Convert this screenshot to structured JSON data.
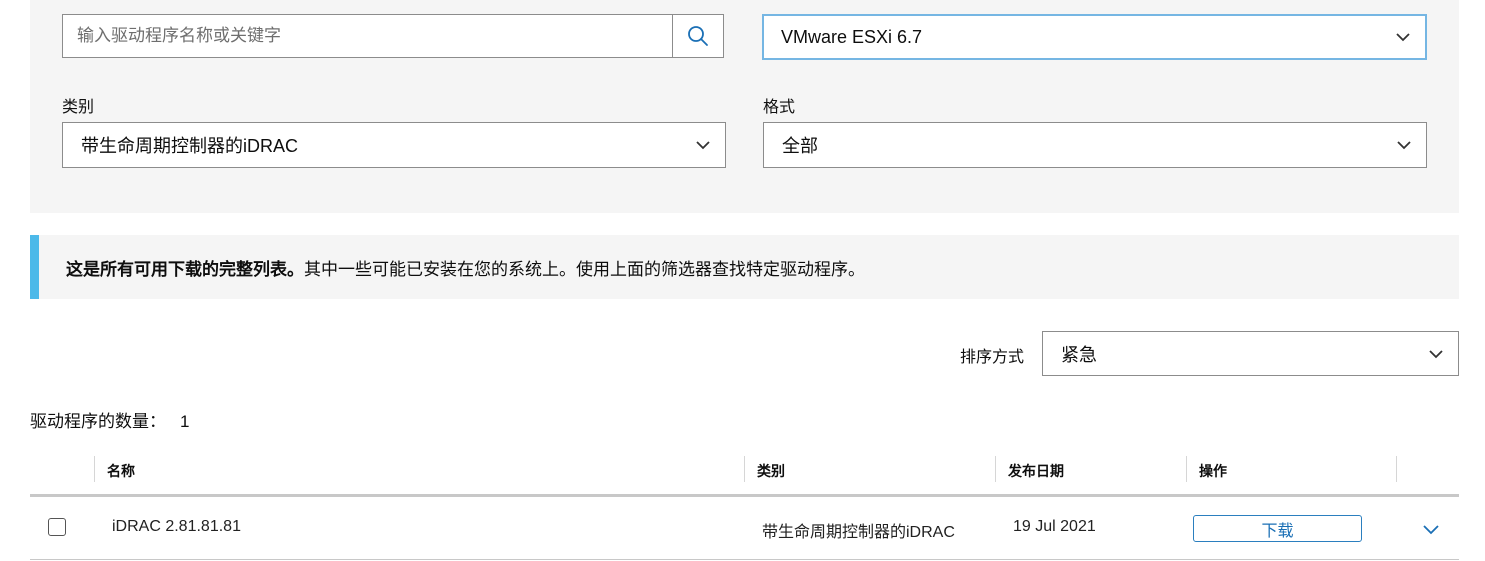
{
  "filters": {
    "search": {
      "placeholder": "输入驱动程序名称或关键字"
    },
    "os": {
      "value": "VMware ESXi 6.7"
    },
    "category": {
      "label": "类别",
      "value": "带生命周期控制器的iDRAC"
    },
    "format": {
      "label": "格式",
      "value": "全部"
    }
  },
  "notice": {
    "bold": "这是所有可用下载的完整列表。",
    "text": "其中一些可能已安装在您的系统上。使用上面的筛选器查找特定驱动程序。"
  },
  "sort": {
    "label": "排序方式",
    "value": "紧急"
  },
  "count": {
    "label": "驱动程序的数量：",
    "value": "1"
  },
  "table": {
    "headers": {
      "name": "名称",
      "category": "类别",
      "date": "发布日期",
      "action": "操作"
    },
    "rows": [
      {
        "name": "iDRAC 2.81.81.81",
        "category": "带生命周期控制器的iDRAC",
        "date": "19 Jul 2021",
        "action": "下载"
      }
    ]
  },
  "colors": {
    "accent": "#4cb9e9",
    "link": "#1a6fb5",
    "panel": "#f5f5f5"
  }
}
